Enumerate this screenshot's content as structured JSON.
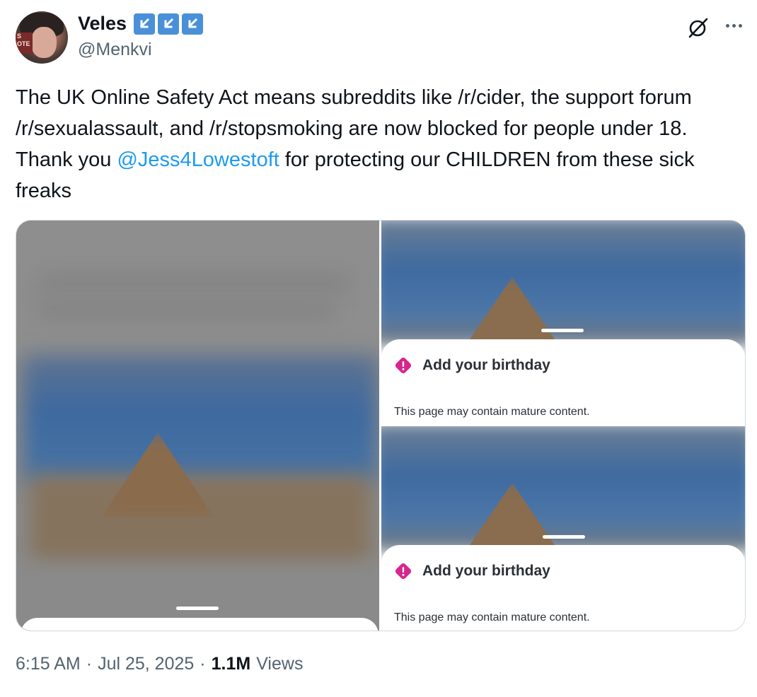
{
  "author": {
    "display_name": "Veles",
    "handle": "@Menkvi",
    "badges": [
      "arrow-down-left-icon",
      "arrow-down-left-icon",
      "arrow-down-left-icon"
    ],
    "avatar_sign_text": "S\nOTE"
  },
  "tweet": {
    "text_before": "The UK Online Safety Act means subreddits like /r/cider, the support forum /r/sexualassault, and /r/stopsmoking are now blocked for people under 18. Thank you ",
    "mention": "@Jess4Lowestoft",
    "text_after": " for protecting our CHILDREN from these sick freaks"
  },
  "media": {
    "images": [
      {
        "sheet_title": "Add your birthday",
        "sheet_description": "This page may contain mature content."
      },
      {
        "sheet_title": "Add your birthday",
        "sheet_description": "This page may contain mature content."
      }
    ]
  },
  "footer": {
    "time": "6:15 AM",
    "separator": "·",
    "date": "Jul 25, 2025",
    "views_count": "1.1M",
    "views_label": "Views"
  },
  "colors": {
    "mention": "#1d9bf0",
    "badge": "#4a90d9",
    "warning": "#d7268f",
    "secondary_text": "#536471"
  }
}
